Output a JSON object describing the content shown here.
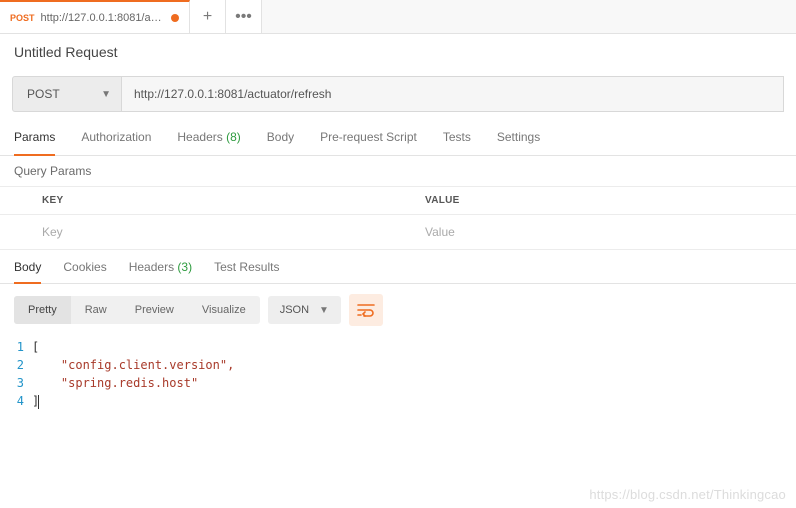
{
  "tab": {
    "method_badge": "POST",
    "label": "http://127.0.0.1:8081/actuator..."
  },
  "title": "Untitled Request",
  "request": {
    "method": "POST",
    "url": "http://127.0.0.1:8081/actuator/refresh"
  },
  "req_tabs": {
    "params": "Params",
    "authorization": "Authorization",
    "headers": "Headers",
    "headers_count": "(8)",
    "body": "Body",
    "prerequest": "Pre-request Script",
    "tests": "Tests",
    "settings": "Settings"
  },
  "params_section": {
    "title": "Query Params",
    "col_key": "KEY",
    "col_value": "VALUE",
    "placeholder_key": "Key",
    "placeholder_value": "Value"
  },
  "resp_tabs": {
    "body": "Body",
    "cookies": "Cookies",
    "headers": "Headers",
    "headers_count": "(3)",
    "test_results": "Test Results"
  },
  "view": {
    "pretty": "Pretty",
    "raw": "Raw",
    "preview": "Preview",
    "visualize": "Visualize",
    "format": "JSON"
  },
  "response_body": {
    "lines": [
      "1",
      "2",
      "3",
      "4"
    ],
    "l1": "[",
    "l2": "    \"config.client.version\",",
    "l3": "    \"spring.redis.host\"",
    "l4": "]"
  },
  "watermark": "https://blog.csdn.net/Thinkingcao"
}
